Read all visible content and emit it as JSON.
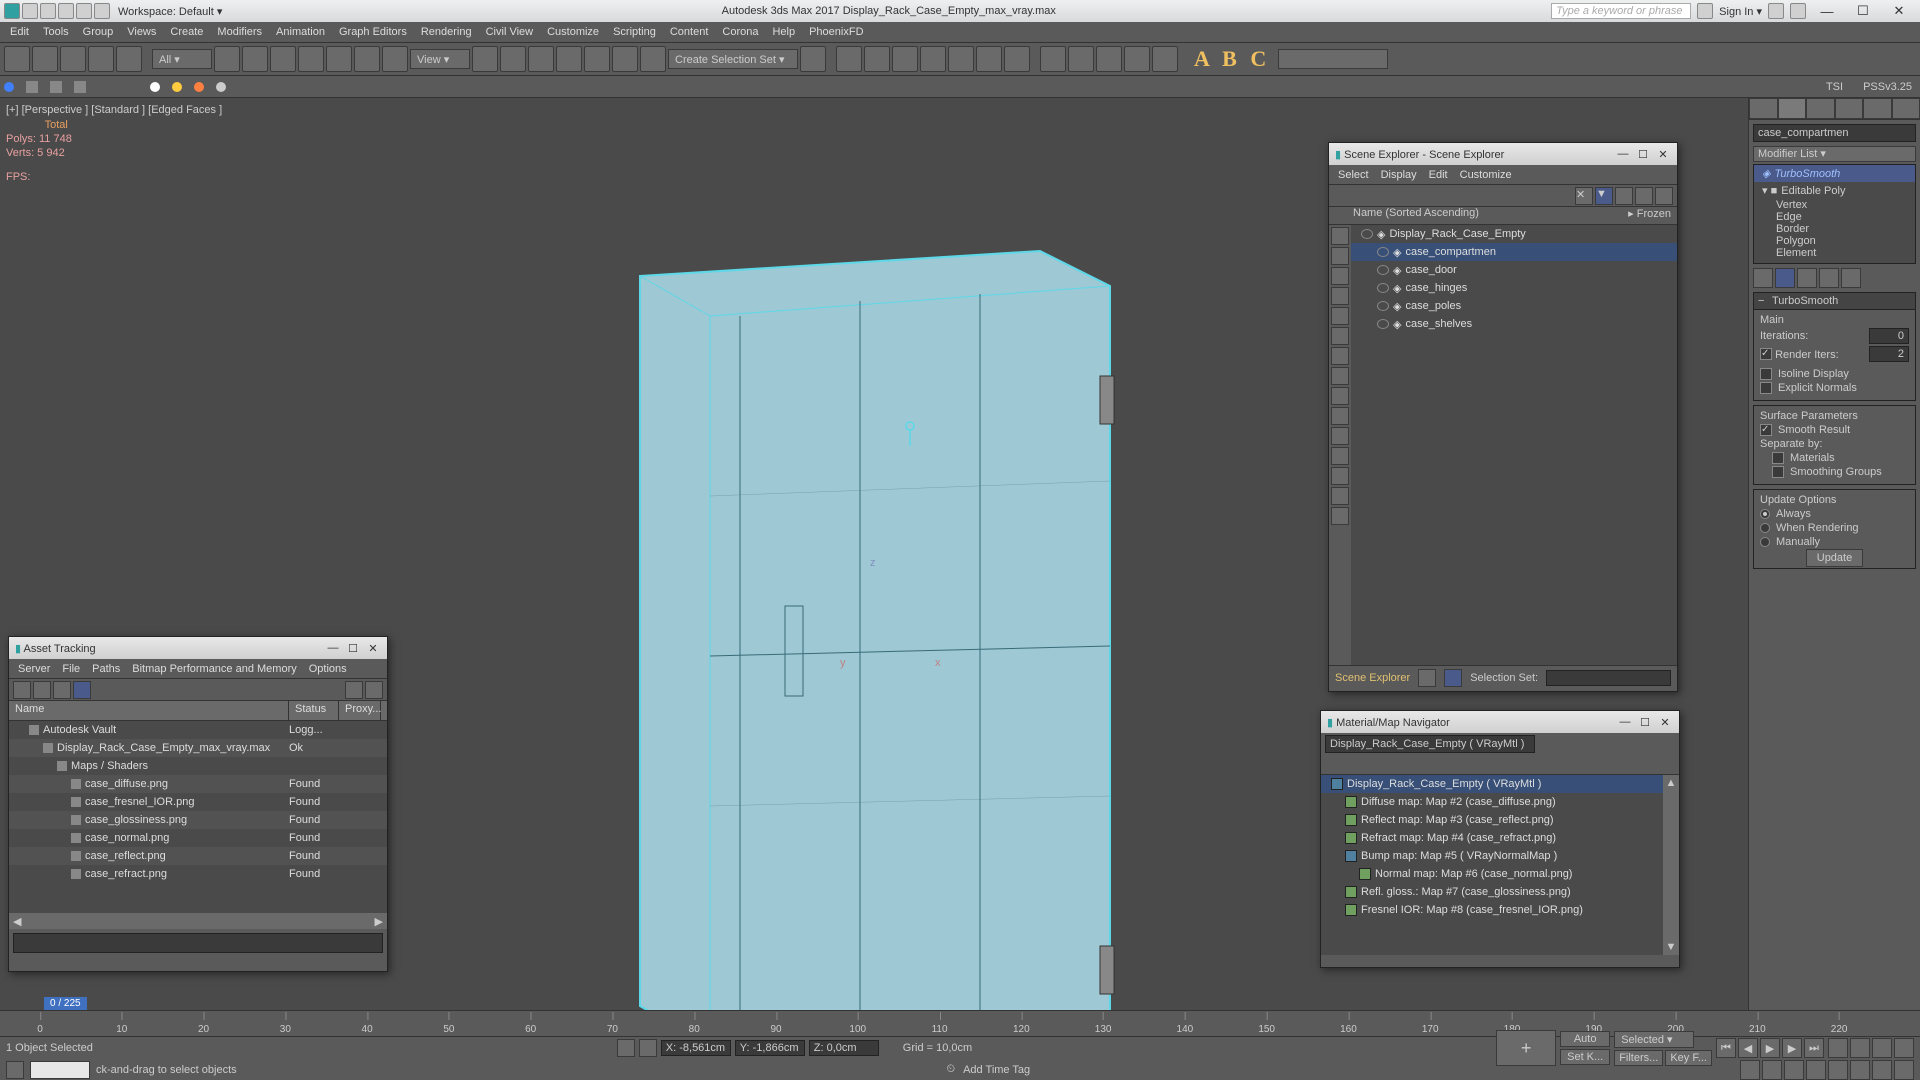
{
  "titlebar": {
    "workspace": "Workspace: Default ▾",
    "center": "Autodesk 3ds Max 2017     Display_Rack_Case_Empty_max_vray.max",
    "search_placeholder": "Type a keyword or phrase",
    "signin": "Sign In ▾"
  },
  "menus": [
    "Edit",
    "Tools",
    "Group",
    "Views",
    "Create",
    "Modifiers",
    "Animation",
    "Graph Editors",
    "Rendering",
    "Civil View",
    "Customize",
    "Scripting",
    "Content",
    "Corona",
    "Help",
    "PhoenixFD"
  ],
  "toolbar": {
    "dd_all": "All ▾",
    "dd_view": "View ▾",
    "dd_sel": "Create Selection Set ▾",
    "abc": "A B C"
  },
  "toolbar2": {
    "tsi": "TSI",
    "pss": "PSSv3.25"
  },
  "viewport": {
    "label": "[+] [Perspective ]  [Standard ]  [Edged Faces ]",
    "total": "Total",
    "polys": "Polys:   11 748",
    "verts": "Verts:   5 942",
    "fps": "FPS:"
  },
  "cmdpanel": {
    "name": "case_compartmen",
    "modlist": "Modifier List ▾",
    "stack": {
      "top": "TurboSmooth",
      "base": "Editable Poly",
      "subs": [
        "Vertex",
        "Edge",
        "Border",
        "Polygon",
        "Element"
      ]
    },
    "roll1": {
      "title": "TurboSmooth",
      "main": "Main",
      "iter": "Iterations:",
      "iter_v": "0",
      "riter": "Render Iters:",
      "riter_v": "2",
      "iso": "Isoline Display",
      "expn": "Explicit Normals"
    },
    "roll2": {
      "title": "Surface Parameters",
      "smooth": "Smooth Result",
      "sep": "Separate by:",
      "mat": "Materials",
      "sg": "Smoothing Groups"
    },
    "roll3": {
      "title": "Update Options",
      "always": "Always",
      "render": "When Rendering",
      "manual": "Manually",
      "update": "Update"
    }
  },
  "asset": {
    "title": "Asset Tracking",
    "menus": [
      "Server",
      "File",
      "Paths",
      "Bitmap Performance and Memory",
      "Options"
    ],
    "cols": {
      "name": "Name",
      "status": "Status",
      "proxy": "Proxy..."
    },
    "rows": [
      {
        "name": "Autodesk Vault",
        "status": "Logg...",
        "indent": 1,
        "icon": "v"
      },
      {
        "name": "Display_Rack_Case_Empty_max_vray.max",
        "status": "Ok",
        "indent": 2,
        "icon": "f"
      },
      {
        "name": "Maps / Shaders",
        "status": "",
        "indent": 3,
        "icon": "fo"
      },
      {
        "name": "case_diffuse.png",
        "status": "Found",
        "indent": 4,
        "icon": "m"
      },
      {
        "name": "case_fresnel_IOR.png",
        "status": "Found",
        "indent": 4,
        "icon": "m"
      },
      {
        "name": "case_glossiness.png",
        "status": "Found",
        "indent": 4,
        "icon": "m"
      },
      {
        "name": "case_normal.png",
        "status": "Found",
        "indent": 4,
        "icon": "m"
      },
      {
        "name": "case_reflect.png",
        "status": "Found",
        "indent": 4,
        "icon": "m"
      },
      {
        "name": "case_refract.png",
        "status": "Found",
        "indent": 4,
        "icon": "m"
      }
    ]
  },
  "scene": {
    "title": "Scene Explorer - Scene Explorer",
    "menus": [
      "Select",
      "Display",
      "Edit",
      "Customize"
    ],
    "col1": "Name (Sorted Ascending)",
    "col2": "▸ Frozen",
    "rows": [
      {
        "name": "Display_Rack_Case_Empty",
        "indent": 0
      },
      {
        "name": "case_compartmen",
        "indent": 1,
        "sel": true
      },
      {
        "name": "case_door",
        "indent": 1
      },
      {
        "name": "case_hinges",
        "indent": 1
      },
      {
        "name": "case_poles",
        "indent": 1
      },
      {
        "name": "case_shelves",
        "indent": 1
      }
    ],
    "foot": "Scene Explorer",
    "selset": "Selection Set:"
  },
  "mat": {
    "title": "Material/Map Navigator",
    "field": "Display_Rack_Case_Empty  ( VRayMtl )",
    "rows": [
      {
        "t": "Display_Rack_Case_Empty  ( VRayMtl )",
        "sel": true,
        "c": "b"
      },
      {
        "t": "Diffuse map: Map #2 (case_diffuse.png)",
        "c": "g"
      },
      {
        "t": "Reflect map: Map #3 (case_reflect.png)",
        "c": "g"
      },
      {
        "t": "Refract map: Map #4 (case_refract.png)",
        "c": "g"
      },
      {
        "t": "Bump map: Map #5  ( VRayNormalMap )",
        "c": "b"
      },
      {
        "t": "Normal map: Map #6 (case_normal.png)",
        "c": "g"
      },
      {
        "t": "Refl. gloss.: Map #7 (case_glossiness.png)",
        "c": "g"
      },
      {
        "t": "Fresnel IOR: Map #8 (case_fresnel_IOR.png)",
        "c": "g"
      }
    ]
  },
  "timeline": {
    "frame": "0 / 225",
    "ticks": [
      0,
      10,
      20,
      30,
      40,
      50,
      60,
      70,
      80,
      90,
      100,
      110,
      120,
      130,
      140,
      150,
      160,
      170,
      180,
      190,
      200,
      210,
      220
    ]
  },
  "status": {
    "selected": "1 Object Selected",
    "hint": "ck-and-drag to select objects",
    "x": "X: -8,561cm",
    "y": "Y: -1,866cm",
    "z": "Z: 0,0cm",
    "grid": "Grid = 10,0cm",
    "addtag": "Add Time Tag",
    "auto": "Auto",
    "setk": "Set K...",
    "selected_dd": "Selected ▾",
    "filters": "Filters...",
    "keyf": "Key F..."
  }
}
